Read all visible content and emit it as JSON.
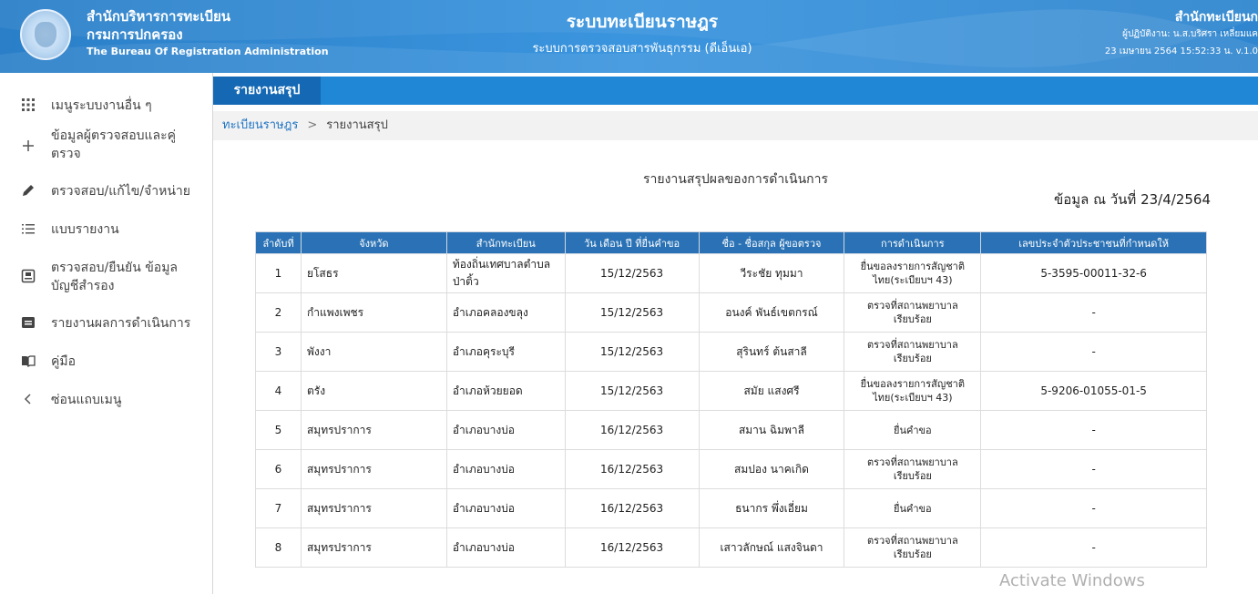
{
  "header": {
    "org_th_line1": "สำนักบริหารการทะเบียน",
    "org_th_line2": "กรมการปกครอง",
    "org_en": "The Bureau Of Registration Administration",
    "system_title": "ระบบทะเบียนราษฎร",
    "system_subtitle": "ระบบการตรวจสอบสารพันธุกรรม (ดีเอ็นเอ)",
    "office": "สำนักทะเบียนก",
    "operator": "ผู้ปฏิบัติงาน: น.ส.บริศรา เหลี่ยมแค",
    "datetime": "23 เมษายน 2564 15:52:33 น.  v.1.0"
  },
  "sidebar": {
    "items": [
      {
        "label": "เมนูระบบงานอื่น ๆ",
        "icon": "apps-grid-icon"
      },
      {
        "label": "ข้อมูลผู้ตรวจสอบและคู่ตรวจ",
        "icon": "plus-icon"
      },
      {
        "label": "ตรวจสอบ/แก้ไข/จำหน่าย",
        "icon": "pencil-icon"
      },
      {
        "label": "แบบรายงาน",
        "icon": "list-icon"
      },
      {
        "label": "ตรวจสอบ/ยืนยัน ข้อมูลบัญชีสำรอง",
        "icon": "id-card-icon"
      },
      {
        "label": "รายงานผลการดำเนินการ",
        "icon": "report-icon"
      },
      {
        "label": "คู่มือ",
        "icon": "book-icon"
      },
      {
        "label": "ซ่อนแถบเมนู",
        "icon": "chevron-left-icon"
      }
    ]
  },
  "topbar": {
    "tab_label": "รายงานสรุป"
  },
  "breadcrumb": {
    "root": "ทะเบียนราษฎร",
    "separator": ">",
    "current": "รายงานสรุป"
  },
  "report": {
    "title": "รายงานสรุปผลของการดำเนินการ",
    "as_of": "ข้อมูล ณ วันที่ 23/4/2564",
    "columns": [
      "ลำดับที่",
      "จังหวัด",
      "สำนักทะเบียน",
      "วัน เดือน ปี ที่ยื่นคำขอ",
      "ชื่อ - ชื่อสกุล ผู้ขอตรวจ",
      "การดำเนินการ",
      "เลขประจำตัวประชาชนที่กำหนดให้"
    ],
    "rows": [
      [
        "1",
        "ยโสธร",
        "ท้องถิ่นเทศบาลตำบลป่าติ้ว",
        "15/12/2563",
        "วีระชัย ทุมมา",
        "ยื่นขอลงรายการสัญชาติไทย(ระเบียบฯ 43)",
        "5-3595-00011-32-6"
      ],
      [
        "2",
        "กำแพงเพชร",
        "อำเภอคลองขลุง",
        "15/12/2563",
        "อนงค์ พันธ์เขตกรณ์",
        "ตรวจที่สถานพยาบาลเรียบร้อย",
        "-"
      ],
      [
        "3",
        "พังงา",
        "อำเภอคุระบุรี",
        "15/12/2563",
        "สุรินทร์ ต้นสาลี",
        "ตรวจที่สถานพยาบาลเรียบร้อย",
        "-"
      ],
      [
        "4",
        "ตรัง",
        "อำเภอห้วยยอด",
        "15/12/2563",
        "สมัย แสงศรี",
        "ยื่นขอลงรายการสัญชาติไทย(ระเบียบฯ 43)",
        "5-9206-01055-01-5"
      ],
      [
        "5",
        "สมุทรปราการ",
        "อำเภอบางบ่อ",
        "16/12/2563",
        "สมาน ฉิมพาลี",
        "ยื่นคำขอ",
        "-"
      ],
      [
        "6",
        "สมุทรปราการ",
        "อำเภอบางบ่อ",
        "16/12/2563",
        "สมปอง นาคเกิด",
        "ตรวจที่สถานพยาบาลเรียบร้อย",
        "-"
      ],
      [
        "7",
        "สมุทรปราการ",
        "อำเภอบางบ่อ",
        "16/12/2563",
        "ธนากร พึ่งเอี่ยม",
        "ยื่นคำขอ",
        "-"
      ],
      [
        "8",
        "สมุทรปราการ",
        "อำเภอบางบ่อ",
        "16/12/2563",
        "เสาวลักษณ์ แสงจินดา",
        "ตรวจที่สถานพยาบาลเรียบร้อย",
        "-"
      ]
    ]
  },
  "watermark": "Activate Windows"
}
